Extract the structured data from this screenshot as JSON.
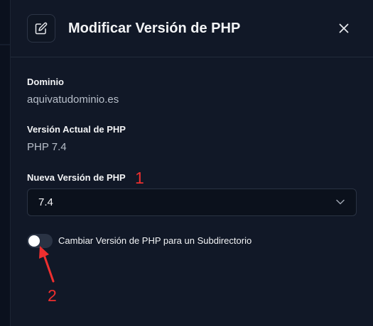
{
  "dialog": {
    "title": "Modificar Versión de PHP",
    "header_icon": "edit-icon",
    "close_icon": "close-icon"
  },
  "fields": {
    "domain_label": "Dominio",
    "domain_value": "aquivatudominio.es",
    "current_label": "Versión Actual de PHP",
    "current_value": "PHP 7.4",
    "new_label": "Nueva Versión de PHP",
    "new_selected": "7.4"
  },
  "subdirectory_toggle": {
    "label": "Cambiar Versión de PHP para un Subdirectorio",
    "checked": false
  },
  "annotations": {
    "marker_1": "1",
    "marker_2": "2",
    "color": "#ee2f2f"
  },
  "colors": {
    "panel_bg": "#111827",
    "page_bg": "#0b111e",
    "text_primary": "#f3f4f6",
    "text_secondary": "#b8bfca"
  }
}
